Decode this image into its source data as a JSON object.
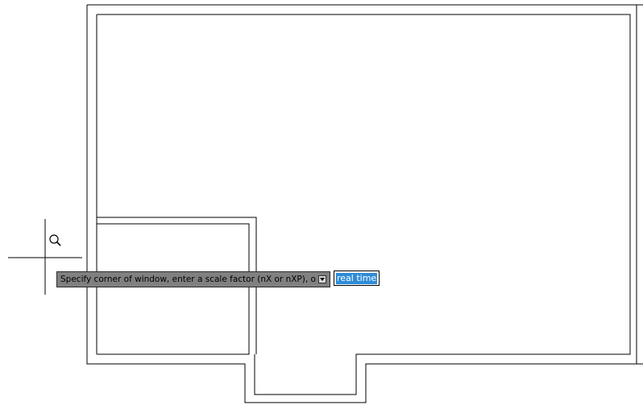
{
  "viewport": {
    "name": "drawing-area",
    "background": "#ffffff",
    "line_color": "#000000"
  },
  "cursor": {
    "icon": "zoom-magnifier-icon",
    "crosshair": "crosshair-icon"
  },
  "command_prompt": {
    "text": "Specify corner of window, enter a scale factor (nX or nXP), or",
    "options_icon": "dropdown-arrow-icon",
    "background": "#808080"
  },
  "option_input": {
    "value": "real time",
    "highlight_color": "#2e8cd8"
  }
}
